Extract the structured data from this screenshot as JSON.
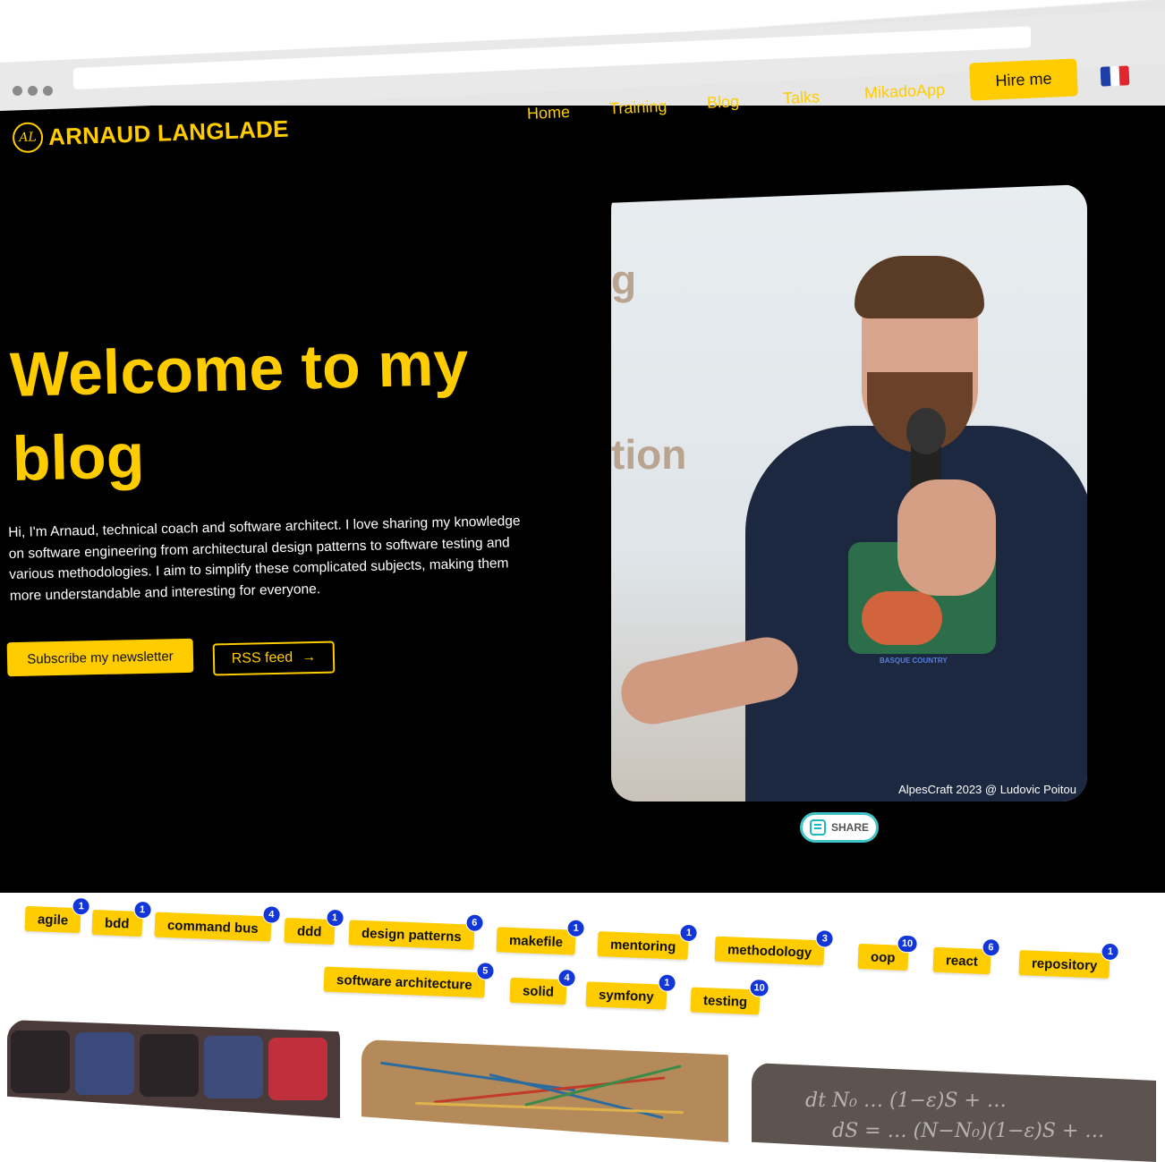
{
  "site": {
    "logo_mark": "AL",
    "logo_text": "ARNAUD LANGLADE"
  },
  "nav": {
    "items": [
      "Home",
      "Training",
      "Blog",
      "Talks",
      "MikadoApp"
    ],
    "hire": "Hire me",
    "flag": "french-flag-icon"
  },
  "hero": {
    "title": "Welcome to my blog",
    "text": "Hi, I'm Arnaud, technical coach and software architect. I love sharing my knowledge on software engineering from architectural design patterns to software testing and various methodologies. I aim to simplify these complicated subjects, making them more understandable and interesting for everyone.",
    "subscribe": "Subscribe my newsletter",
    "rss": "RSS feed",
    "rss_arrow": "→",
    "photo_caption": "AlpesCraft 2023 @ Ludovic Poitou",
    "photo_bg_text_1": "g",
    "photo_bg_text_2": "tion",
    "shirt_text": "BASQUE COUNTRY"
  },
  "share": {
    "label": "SHARE"
  },
  "tags": [
    {
      "name": "agile",
      "count": "1"
    },
    {
      "name": "bdd",
      "count": "1"
    },
    {
      "name": "command bus",
      "count": "4"
    },
    {
      "name": "ddd",
      "count": "1"
    },
    {
      "name": "design patterns",
      "count": "6"
    },
    {
      "name": "makefile",
      "count": "1"
    },
    {
      "name": "mentoring",
      "count": "1"
    },
    {
      "name": "methodology",
      "count": "3"
    },
    {
      "name": "oop",
      "count": "10"
    },
    {
      "name": "react",
      "count": "6"
    },
    {
      "name": "repository",
      "count": "1"
    },
    {
      "name": "software architecture",
      "count": "5"
    },
    {
      "name": "solid",
      "count": "4"
    },
    {
      "name": "symfony",
      "count": "1"
    },
    {
      "name": "testing",
      "count": "10"
    }
  ],
  "colors": {
    "accent": "#ffcc00",
    "background": "#000000",
    "badge": "#1336d8"
  }
}
